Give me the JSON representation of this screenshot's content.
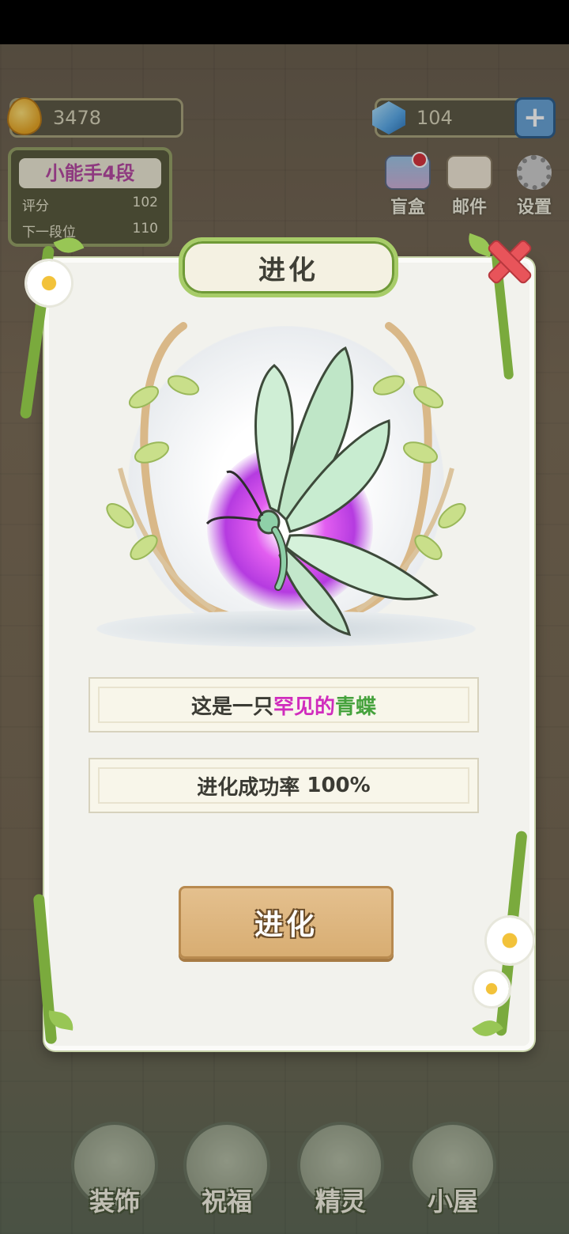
{
  "resources": {
    "coins": "3478",
    "gems": "104",
    "coin_icon": "droplet-coin-icon",
    "gem_icon": "crystal-cube-icon",
    "add_icon": "plus-icon"
  },
  "rank_panel": {
    "title": "小能手4段",
    "score_label": "评分",
    "score_value": "102",
    "next_label": "下一段位",
    "next_value": "110"
  },
  "top_tools": [
    {
      "label": "盲盒",
      "icon": "gift-box-icon"
    },
    {
      "label": "邮件",
      "icon": "envelope-icon"
    },
    {
      "label": "设置",
      "icon": "gear-icon"
    }
  ],
  "dialog": {
    "title": "进化",
    "description_prefix": "这是一只",
    "description_rarity": "罕见的",
    "description_name": "青蝶",
    "success_rate_label": "进化成功率",
    "success_rate_value": "100%",
    "action_label": "进化",
    "close_icon": "close-icon"
  },
  "bottom_nav": [
    {
      "label": "装饰",
      "icon": "plant-pot-icon"
    },
    {
      "label": "祝福",
      "icon": "butterflies-icon"
    },
    {
      "label": "精灵",
      "icon": "fairy-avatar-icon"
    },
    {
      "label": "小屋",
      "icon": "house-icon"
    }
  ],
  "colors": {
    "rarity": "#d02cbd",
    "name": "#45a23c",
    "button": "#d8ad72",
    "close": "#e8545a"
  }
}
